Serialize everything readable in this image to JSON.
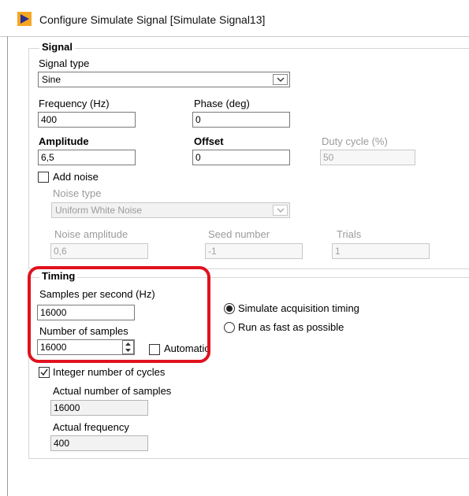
{
  "window": {
    "title": "Configure Simulate Signal [Simulate Signal13]"
  },
  "signal": {
    "group_title": "Signal",
    "signal_type_label": "Signal type",
    "signal_type_value": "Sine",
    "frequency_label": "Frequency (Hz)",
    "frequency_value": "400",
    "phase_label": "Phase (deg)",
    "phase_value": "0",
    "amplitude_label": "Amplitude",
    "amplitude_value": "6,5",
    "offset_label": "Offset",
    "offset_value": "0",
    "duty_cycle_label": "Duty cycle (%)",
    "duty_cycle_value": "50",
    "add_noise_label": "Add noise",
    "add_noise_checked": false,
    "noise_type_label": "Noise type",
    "noise_type_value": "Uniform White Noise",
    "noise_amplitude_label": "Noise amplitude",
    "noise_amplitude_value": "0,6",
    "seed_number_label": "Seed number",
    "seed_number_value": "-1",
    "trials_label": "Trials",
    "trials_value": "1"
  },
  "timing": {
    "group_title": "Timing",
    "samples_per_second_label": "Samples per second (Hz)",
    "samples_per_second_value": "16000",
    "number_of_samples_label": "Number of samples",
    "number_of_samples_value": "16000",
    "automatic_label": "Automatic",
    "automatic_checked": false,
    "simulate_timing_label": "Simulate acquisition timing",
    "simulate_timing_selected": true,
    "run_fast_label": "Run as fast as possible",
    "run_fast_selected": false,
    "integer_cycles_label": "Integer number of cycles",
    "integer_cycles_checked": true,
    "actual_samples_label": "Actual number of samples",
    "actual_samples_value": "16000",
    "actual_frequency_label": "Actual frequency",
    "actual_frequency_value": "400"
  },
  "colors": {
    "app_icon_bg": "#f5a623",
    "app_icon_fg": "#2b2f8f",
    "annotation": "#e0121e"
  }
}
